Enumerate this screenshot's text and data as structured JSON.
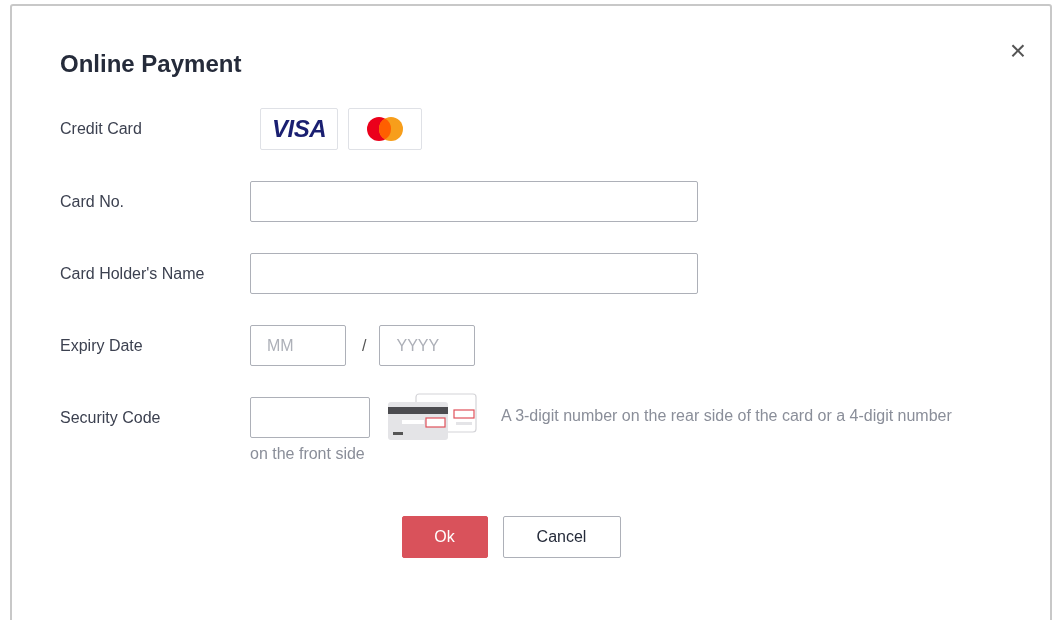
{
  "dialog": {
    "title": "Online Payment",
    "close": "×"
  },
  "fields": [
    {
      "kind": "brands",
      "label": "Credit Card",
      "brands": [
        {
          "kind": "visa",
          "label": "VISA"
        },
        {
          "kind": "mastercard"
        }
      ]
    },
    {
      "kind": "text",
      "label": "Card No."
    },
    {
      "kind": "text",
      "label": "Card Holder's Name"
    },
    {
      "kind": "expiry",
      "label": "Expiry Date",
      "month_placeholder": "MM",
      "separator": "/",
      "year_placeholder": "YYYY"
    },
    {
      "kind": "cvv",
      "label": "Security Code",
      "hint_lines": [
        "A 3-digit number on the rear side of the card or a 4-digit number",
        "on the front side"
      ]
    }
  ],
  "buttons": [
    {
      "kind": "primary",
      "label": "Ok"
    },
    {
      "kind": "secondary",
      "label": "Cancel"
    }
  ]
}
